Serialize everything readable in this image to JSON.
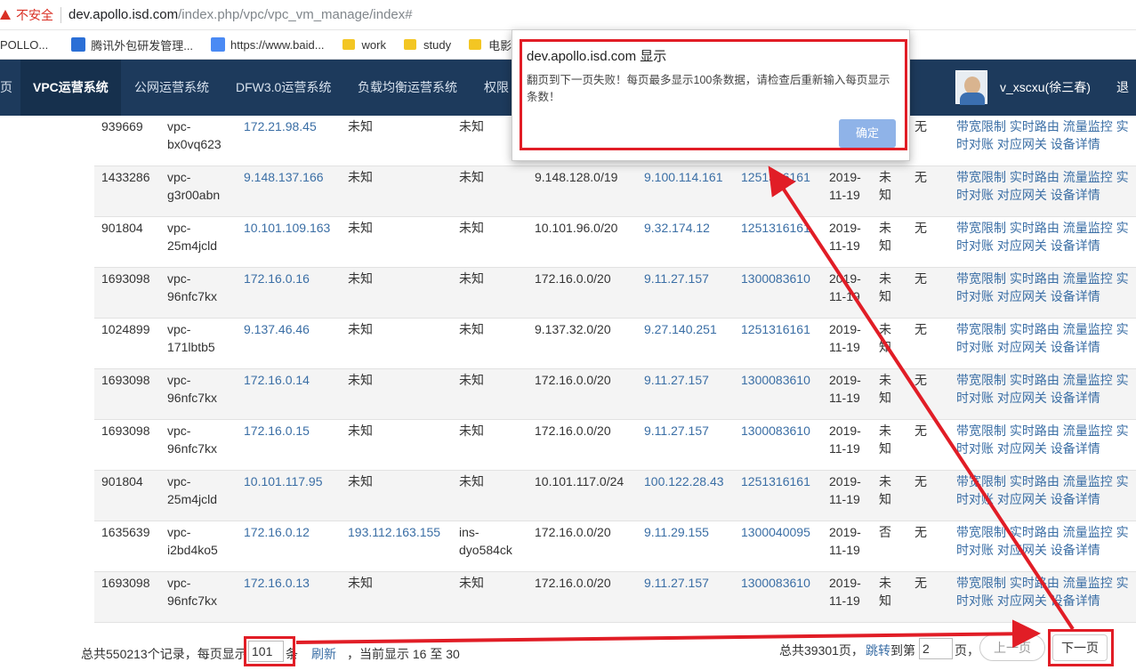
{
  "browser": {
    "insecure_label": "不安全",
    "url_host": "dev.apollo.isd.com",
    "url_path": "/index.php/vpc/vpc_vm_manage/index#",
    "bookmarks": [
      "POLLO...",
      "腾讯外包研发管理...",
      "https://www.baid...",
      "work",
      "study",
      "电影"
    ]
  },
  "nav": {
    "items": [
      "页",
      "VPC运营系统",
      "公网运营系统",
      "DFW3.0运营系统",
      "负载均衡运营系统",
      "权限"
    ],
    "user": "v_xscxu(徐三春)",
    "logout": "退出"
  },
  "table": {
    "rows": [
      {
        "id": "939669",
        "vpc": [
          "vpc-",
          "bx0vq623"
        ],
        "ip": "172.21.98.45",
        "eip": "未知",
        "ins": [
          "未知"
        ],
        "cidr": "",
        "host": "",
        "app": "",
        "date": [
          "",
          ""
        ],
        "state": [
          "",
          ""
        ],
        "flag": "无"
      },
      {
        "id": "1433286",
        "vpc": [
          "vpc-",
          "g3r00abn"
        ],
        "ip": "9.148.137.166",
        "eip": "未知",
        "ins": [
          "未知"
        ],
        "cidr": "9.148.128.0/19",
        "host": "9.100.114.161",
        "app": "1251316161",
        "date": [
          "2019-",
          "11-19"
        ],
        "state": [
          "未",
          "知"
        ],
        "flag": "无"
      },
      {
        "id": "901804",
        "vpc": [
          "vpc-",
          "25m4jcld"
        ],
        "ip": "10.101.109.163",
        "eip": "未知",
        "ins": [
          "未知"
        ],
        "cidr": "10.101.96.0/20",
        "host": "9.32.174.12",
        "app": "1251316161",
        "date": [
          "2019-",
          "11-19"
        ],
        "state": [
          "未",
          "知"
        ],
        "flag": "无"
      },
      {
        "id": "1693098",
        "vpc": [
          "vpc-",
          "96nfc7kx"
        ],
        "ip": "172.16.0.16",
        "eip": "未知",
        "ins": [
          "未知"
        ],
        "cidr": "172.16.0.0/20",
        "host": "9.11.27.157",
        "app": "1300083610",
        "date": [
          "2019-",
          "11-19"
        ],
        "state": [
          "未",
          "知"
        ],
        "flag": "无"
      },
      {
        "id": "1024899",
        "vpc": [
          "vpc-",
          "171lbtb5"
        ],
        "ip": "9.137.46.46",
        "eip": "未知",
        "ins": [
          "未知"
        ],
        "cidr": "9.137.32.0/20",
        "host": "9.27.140.251",
        "app": "1251316161",
        "date": [
          "2019-",
          "11-19"
        ],
        "state": [
          "未",
          "知"
        ],
        "flag": "无"
      },
      {
        "id": "1693098",
        "vpc": [
          "vpc-",
          "96nfc7kx"
        ],
        "ip": "172.16.0.14",
        "eip": "未知",
        "ins": [
          "未知"
        ],
        "cidr": "172.16.0.0/20",
        "host": "9.11.27.157",
        "app": "1300083610",
        "date": [
          "2019-",
          "11-19"
        ],
        "state": [
          "未",
          "知"
        ],
        "flag": "无"
      },
      {
        "id": "1693098",
        "vpc": [
          "vpc-",
          "96nfc7kx"
        ],
        "ip": "172.16.0.15",
        "eip": "未知",
        "ins": [
          "未知"
        ],
        "cidr": "172.16.0.0/20",
        "host": "9.11.27.157",
        "app": "1300083610",
        "date": [
          "2019-",
          "11-19"
        ],
        "state": [
          "未",
          "知"
        ],
        "flag": "无"
      },
      {
        "id": "901804",
        "vpc": [
          "vpc-",
          "25m4jcld"
        ],
        "ip": "10.101.117.95",
        "eip": "未知",
        "ins": [
          "未知"
        ],
        "cidr": "10.101.117.0/24",
        "host": "100.122.28.43",
        "app": "1251316161",
        "date": [
          "2019-",
          "11-19"
        ],
        "state": [
          "未",
          "知"
        ],
        "flag": "无"
      },
      {
        "id": "1635639",
        "vpc": [
          "vpc-",
          "i2bd4ko5"
        ],
        "ip": "172.16.0.12",
        "eip": "193.112.163.155",
        "ins": [
          "ins-",
          "dyo584ck"
        ],
        "cidr": "172.16.0.0/20",
        "host": "9.11.29.155",
        "app": "1300040095",
        "date": [
          "2019-",
          "11-19"
        ],
        "state": [
          "否",
          ""
        ],
        "flag": "无"
      },
      {
        "id": "1693098",
        "vpc": [
          "vpc-",
          "96nfc7kx"
        ],
        "ip": "172.16.0.13",
        "eip": "未知",
        "ins": [
          "未知"
        ],
        "cidr": "172.16.0.0/20",
        "host": "9.11.27.157",
        "app": "1300083610",
        "date": [
          "2019-",
          "11-19"
        ],
        "state": [
          "未",
          "知"
        ],
        "flag": "无"
      }
    ],
    "ops_line1": "带宽限制 实时路由 流量监控 实",
    "ops_line2": "时对账 对应网关 设备详情"
  },
  "footer": {
    "total_records": "总共550213个记录，每页显示",
    "per_page_value": "101",
    "per_page_unit": "条",
    "refresh": "刷新",
    "current": "，当前显示 16 至 30",
    "total_pages": "总共39301页，",
    "jump_label": "跳转",
    "jump_to": "到第",
    "jump_value": "2",
    "page_unit": "页，",
    "prev": "上一页",
    "next": "下一页"
  },
  "dialog": {
    "title": "dev.apollo.isd.com 显示",
    "message": "翻页到下一页失败！每页最多显示100条数据，请检查后重新输入每页显示条数！",
    "ok": "确定"
  },
  "colors": {
    "nav_bg": "#1d3a5c",
    "link": "#3a6ea5",
    "annotation_red": "#e11d26",
    "ok_button": "#8fb3e8"
  }
}
